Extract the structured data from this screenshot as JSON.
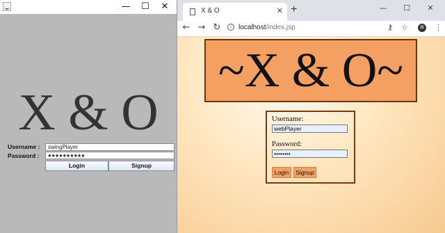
{
  "swing": {
    "window_controls": {
      "minimize": "—",
      "maximize": "☐",
      "close": "✕"
    },
    "title": "X & O",
    "username_label": "Username :",
    "username_value": "swingPlayer",
    "password_label": "Password :",
    "password_value": "●●●●●●●●●●",
    "login_label": "Login",
    "signup_label": "Signup"
  },
  "browser": {
    "tab_title": "X & O",
    "tab_close": "✕",
    "new_tab": "+",
    "window_controls": {
      "minimize": "—",
      "maximize": "☐",
      "close": "✕"
    },
    "nav": {
      "back": "←",
      "forward": "→",
      "reload": "↻"
    },
    "info": "i",
    "url_host": "localhost",
    "url_path": "/index.jsp",
    "toolbar_icons": {
      "key": "⚷",
      "star": "☆",
      "menu": "⋮"
    }
  },
  "page": {
    "banner": "~X & O~",
    "username_label": "Username:",
    "username_value": "webPlayer",
    "password_label": "Password:",
    "password_value": "••••••••",
    "login_label": "Login",
    "signup_label": "Signup"
  },
  "colors": {
    "swing_bg": "#b9b9b9",
    "banner_bg": "#f4a063",
    "banner_border": "#6b3510",
    "button_bg": "#f4a063",
    "page_gradient_light": "#fffaf2",
    "page_gradient_dark": "#f7c990"
  }
}
